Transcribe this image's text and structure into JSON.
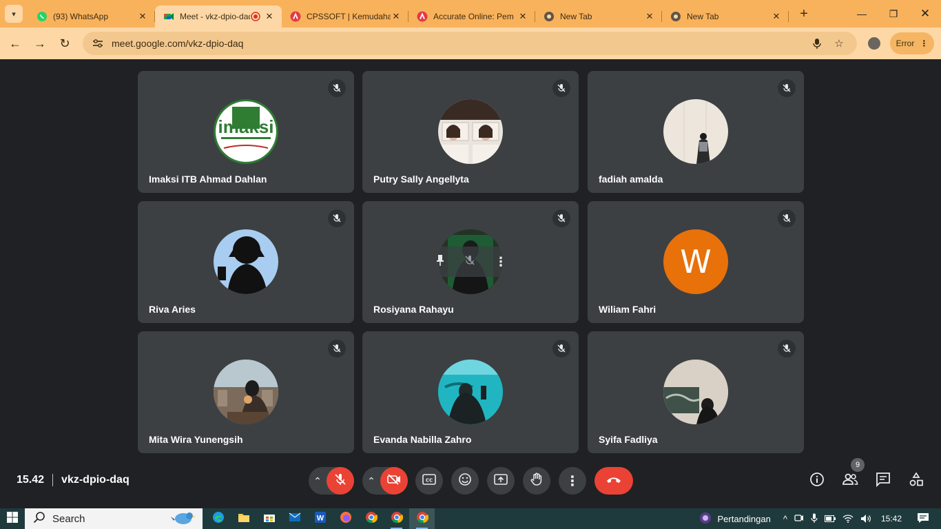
{
  "browser": {
    "tabs": [
      {
        "title": "(93) WhatsApp",
        "icon": "whatsapp-icon",
        "active": false
      },
      {
        "title": "Meet - vkz-dpio-daq",
        "icon": "google-meet-icon",
        "active": true
      },
      {
        "title": "CPSSOFT | Kemudahan",
        "icon": "accurate-icon",
        "active": false
      },
      {
        "title": "Accurate Online: Pem",
        "icon": "accurate-icon",
        "active": false
      },
      {
        "title": "New Tab",
        "icon": "chrome-icon",
        "active": false
      },
      {
        "title": "New Tab",
        "icon": "chrome-icon",
        "active": false
      }
    ],
    "url": "meet.google.com/vkz-dpio-daq",
    "error_label": "Error",
    "theme_color": "#f9b25c"
  },
  "participants": [
    {
      "name": "Imaksi ITB Ahmad Dahlan",
      "avatar": "imaksi-logo",
      "logo_text": "imaksi"
    },
    {
      "name": "Putry Sally Angellyta",
      "avatar": "photo"
    },
    {
      "name": "fadiah amalda",
      "avatar": "photo"
    },
    {
      "name": "Riva Aries",
      "avatar": "silhouette"
    },
    {
      "name": "Rosiyana Rahayu",
      "avatar": "photo"
    },
    {
      "name": "Wiliam Fahri",
      "avatar": "letter",
      "letter": "W",
      "color": "#e8710a"
    },
    {
      "name": "Mita Wira Yunengsih",
      "avatar": "photo"
    },
    {
      "name": "Evanda Nabilla Zahro",
      "avatar": "photo"
    },
    {
      "name": "Syifa Fadliya",
      "avatar": "photo"
    }
  ],
  "meeting": {
    "time": "15.42",
    "code": "vkz-dpio-daq",
    "participant_count": "9"
  },
  "taskbar": {
    "search_label": "Search",
    "weather_label": "Pertandingan",
    "clock": "15:42"
  }
}
